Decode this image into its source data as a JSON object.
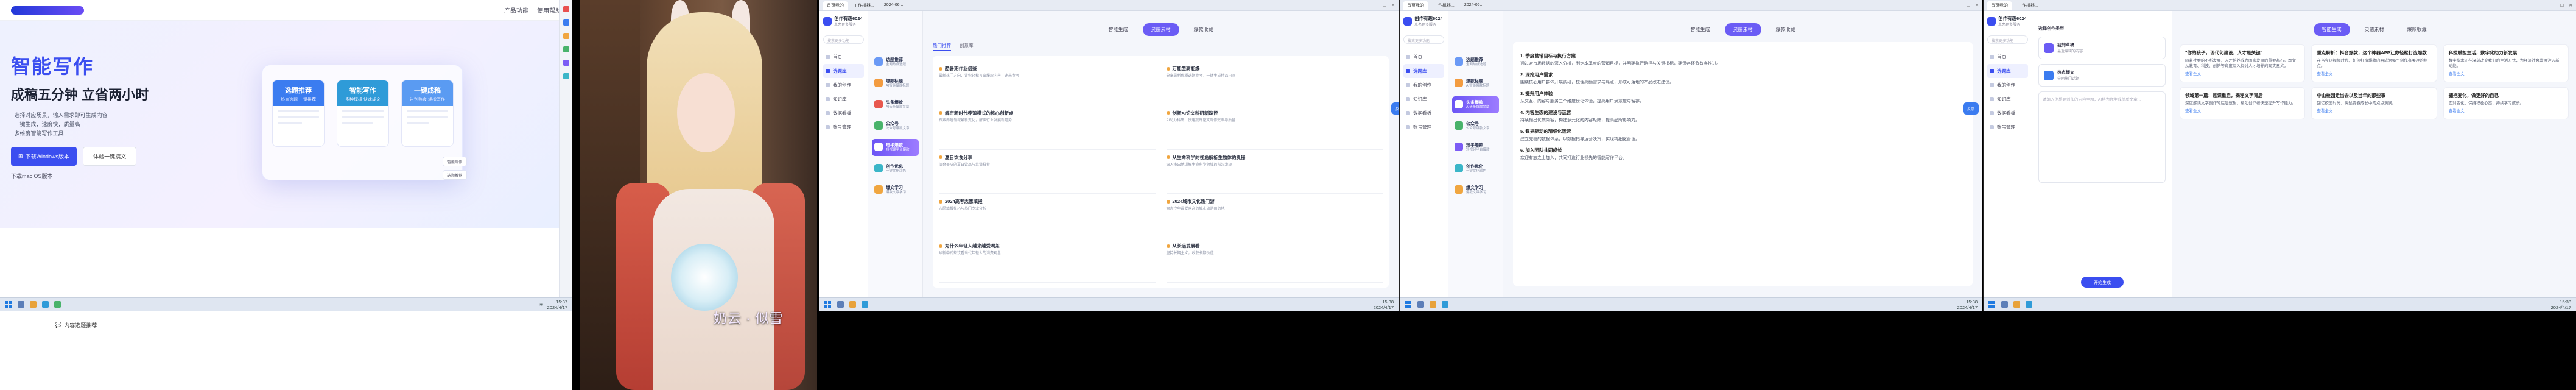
{
  "p1": {
    "nav_links": [
      "产品功能",
      "使用帮助"
    ],
    "hero_title": "智能写作",
    "hero_sub": "成稿五分钟 立省两小时",
    "bullets": [
      "· 选择对应场景，输入需求即可生成内容",
      "· 一键生成，速度快，质量高",
      "· 多维度智能写作工具"
    ],
    "btn_download": "下载Windows版本",
    "btn_experience": "体验一键撰文",
    "mac": "下载mac OS版本",
    "cards": [
      {
        "title": "选题推荐",
        "sub": "热点选题 一键推荐",
        "color": "#3b7cf0"
      },
      {
        "title": "智能写作",
        "sub": "多种模板 快速成文",
        "color": "#2f9bd8"
      },
      {
        "title": "一键成稿",
        "sub": "告别熬夜 轻松写作",
        "color": "#5a9bf2"
      }
    ],
    "floats": [
      "智能写作",
      "选题推荐"
    ],
    "chat": "内容选题推荐",
    "clock_time": "15:37",
    "clock_date": "2024/4/17"
  },
  "photo": {
    "caption": "奶云 · 似雪"
  },
  "app": {
    "tabs": [
      "首页我的",
      "工作机器...",
      "2024-06..."
    ],
    "brand_name": "创作有趣6024",
    "brand_sub": "点亮更多服务",
    "search_placeholder": "搜索更多功能",
    "nav": [
      "首页",
      "选题库",
      "我的创作",
      "知识库",
      "数据看板",
      "账号管理"
    ],
    "tools": [
      {
        "title": "选题推荐",
        "sub": "全网热点选题",
        "color": "#6b9af5"
      },
      {
        "title": "爆款标题",
        "sub": "AI智能爆款标题",
        "color": "#f39c40"
      },
      {
        "title": "头条爆款",
        "sub": "AI头条爆款文章",
        "color": "#e8584e"
      },
      {
        "title": "公众号",
        "sub": "公众号爆款文章",
        "color": "#49b36b"
      },
      {
        "title": "短平爆款",
        "sub": "短视频平台爆款",
        "color": "#7c5cf5"
      },
      {
        "title": "创作优化",
        "sub": "一键优化润色",
        "color": "#3bb6c8"
      },
      {
        "title": "爆文学习",
        "sub": "爆款文章学习",
        "color": "#f0a640"
      }
    ],
    "top_tabs": [
      "智能生成",
      "灵感素材",
      "爆款收藏"
    ],
    "inner_tabs": [
      "热门推荐",
      "创意库"
    ],
    "ideas": [
      {
        "t": "酷暑期作业借鉴",
        "d": "最新热门方向，让你轻松写出爆款内容，速来参考"
      },
      {
        "t": "万能型高能爆",
        "d": "分享最新优质选题参考，一键生成精品内容"
      },
      {
        "t": "解密新时代养殖模式的核心创新点",
        "d": "探索养殖领域最新变化，解读行业发展新趋势"
      },
      {
        "t": "创新AI论文科研新路径",
        "d": "AI助力科研，快速提升论文写作效率与质量"
      },
      {
        "t": "夏日饮食分享",
        "d": "清爽美味的夏日饮品与菜谱推荐"
      },
      {
        "t": "从生命科学的视角解析生物体的奥秘",
        "d": "深入浅出地讲解生命科学领域的前沿发现"
      },
      {
        "t": "2024高考志愿填报",
        "d": "志愿填报技巧与热门专业分析"
      },
      {
        "t": "2024城市文化热门游",
        "d": "盘点今年最受欢迎的城市旅游目的地"
      },
      {
        "t": "为什么年轻人越来越爱喝茶",
        "d": "从新中式茶饮看当代年轻人的消费观念"
      },
      {
        "t": "从长远发展看",
        "d": "坚持长期主义，收获长期价值"
      }
    ],
    "panel3_tab": "头条爆款",
    "article_sections": [
      {
        "t": "1. 季度营销目标与执行方案",
        "d": "通过对市场数据的深入分析，制定本季度的营销目标，并明确执行路径与关键指标，确保各环节有序推进。"
      },
      {
        "t": "2. 深挖用户需求",
        "d": "围绕核心用户群体开展调研，梳理高频需求与痛点，形成可落地的产品改进建议。"
      },
      {
        "t": "3. 提升用户体验",
        "d": "从交互、内容与服务三个维度优化体验，提高用户满意度与留存。"
      },
      {
        "t": "4. 内容生态的建设与运营",
        "d": "持续输出优质内容，构建多元化的内容矩阵，提高品牌影响力。"
      },
      {
        "t": "5. 数据驱动的精细化运营",
        "d": "建立完善的数据体系，以数据指导运营决策，实现精细化管理。"
      },
      {
        "t": "6. 加入团队共同成长",
        "d": "欢迎有志之士加入，共同打造行业领先的智能写作平台。"
      }
    ],
    "float_btn": "反馈",
    "form_section": "选择创作类型",
    "form_cards": [
      {
        "label": "我的草稿",
        "sub": "最近编辑的内容"
      },
      {
        "label": "热点爆文",
        "sub": "全网热门话题"
      }
    ],
    "form_placeholder": "请输入你想要创作的内容主题，AI将为你生成优质文章...",
    "form_go": "开始生成",
    "results": [
      {
        "t": "\"你的孩子，现代化建设，人才是关键\"",
        "d": "随着社会的不断发展，人才培养成为国家发展的重要基石。本文从教育、科技、创新等角度深入探讨人才培养的现实意义。",
        "l": "查看全文"
      },
      {
        "t": "重点解析：抖音爆款，这个神器APP让你轻松打造爆款",
        "d": "在当今短视频时代，如何打造爆款内容成为每个创作者关注的焦点。",
        "l": "查看全文"
      },
      {
        "t": "科技赋能生活，数字化助力新发展",
        "d": "数字技术正在深刻改变我们的生活方式，为经济社会发展注入新动能。",
        "l": "查看全文"
      },
      {
        "t": "领域第一篇：意识重启，揭秘文字背后",
        "d": "深度解读文字创作的底层逻辑，帮助创作者快速提升写作能力。",
        "l": "查看全文"
      },
      {
        "t": "中山校园走出去以及当年的那些事",
        "d": "回忆校园时光，讲述青春成长中的点点滴滴。",
        "l": "查看全文"
      },
      {
        "t": "拥抱变化，做更好的自己",
        "d": "面对变化，保持积极心态，持续学习成长。",
        "l": "查看全文"
      }
    ],
    "clock_time": "15:38",
    "clock_date": "2024/4/17"
  }
}
